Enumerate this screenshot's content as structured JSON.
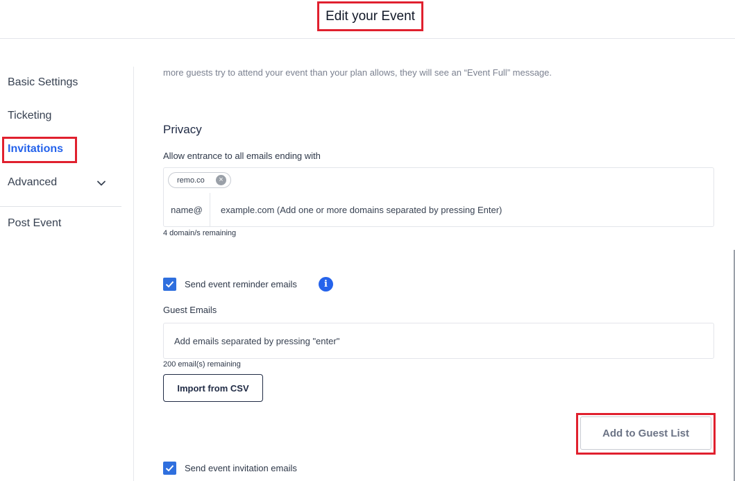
{
  "header": {
    "title": "Edit your Event"
  },
  "sidebar": {
    "items": [
      {
        "label": "Basic Settings"
      },
      {
        "label": "Ticketing"
      },
      {
        "label": "Invitations",
        "active": true
      },
      {
        "label": "Advanced"
      },
      {
        "label": "Post Event"
      }
    ]
  },
  "main": {
    "description": "more guests try to attend your event than your plan allows, they will see an “Event Full” message.",
    "privacy": {
      "heading": "Privacy",
      "allow_label": "Allow entrance to all emails ending with",
      "chip": "remo.co",
      "prefix": "name@",
      "domain_placeholder": "example.com (Add one or more domains separated by pressing Enter)",
      "remaining": "4 domain/s remaining"
    },
    "reminder": {
      "label": "Send event reminder emails",
      "checked": true
    },
    "guests": {
      "label": "Guest Emails",
      "placeholder": "Add emails separated by pressing \"enter\"",
      "remaining": "200 email(s) remaining",
      "import_button": "Import from CSV",
      "add_button": "Add to Guest List"
    },
    "invitation": {
      "label": "Send event invitation emails",
      "checked": true
    }
  },
  "colors": {
    "accent": "#2563eb",
    "highlight": "#e0202e",
    "checkbox": "#2f6fde"
  }
}
